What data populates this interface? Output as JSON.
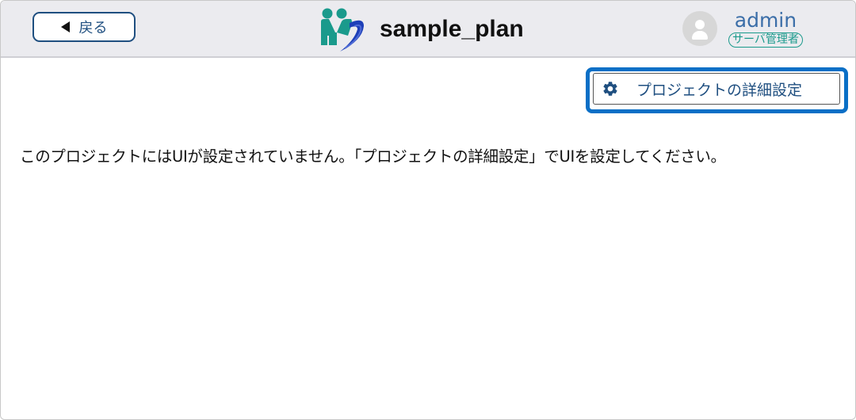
{
  "header": {
    "back_label": "戻る",
    "project_name": "sample_plan",
    "user_name": "admin",
    "user_role": "サーバ管理者"
  },
  "icons": {
    "back": "triangle-left-icon",
    "logo": "app-logo",
    "avatar": "user-avatar-icon",
    "settings": "gear-icon"
  },
  "colors": {
    "header_bg": "#ebebef",
    "accent_blue": "#1f4f80",
    "highlight_blue": "#0a6fc6",
    "teal": "#1a9a8c",
    "user_blue": "#3b6ea8"
  },
  "toolbar": {
    "settings_label": "プロジェクトの詳細設定"
  },
  "main": {
    "message": "このプロジェクトにはUIが設定されていません。「プロジェクトの詳細設定」でUIを設定してください。"
  }
}
